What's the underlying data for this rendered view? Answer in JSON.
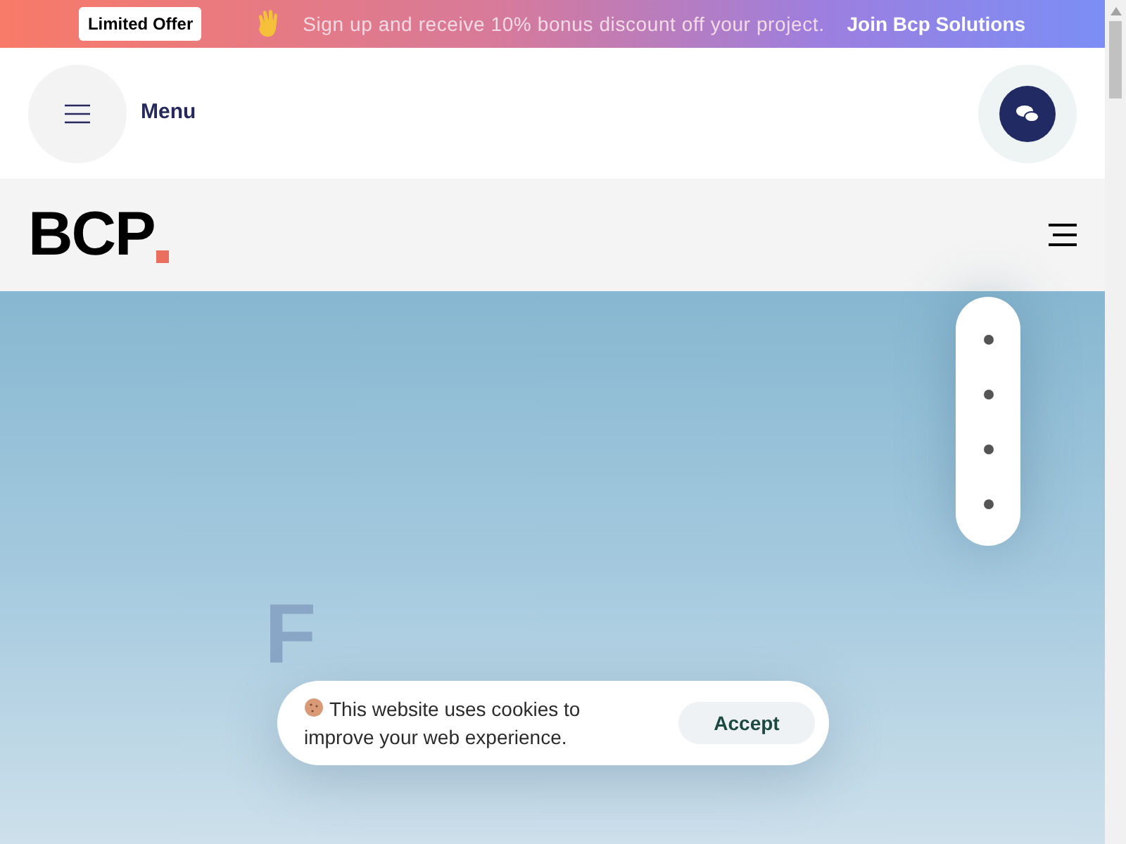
{
  "promo_bar": {
    "badge": "Limited Offer",
    "message": "Sign up and receive 10% bonus discount off your project.",
    "link": "Join Bcp Solutions"
  },
  "header": {
    "menu_label": "Menu"
  },
  "logo": {
    "text": "BCP"
  },
  "hero": {
    "heading": "F"
  },
  "cookie_banner": {
    "message": "This website uses cookies to improve your web experience.",
    "button": "Accept"
  }
}
